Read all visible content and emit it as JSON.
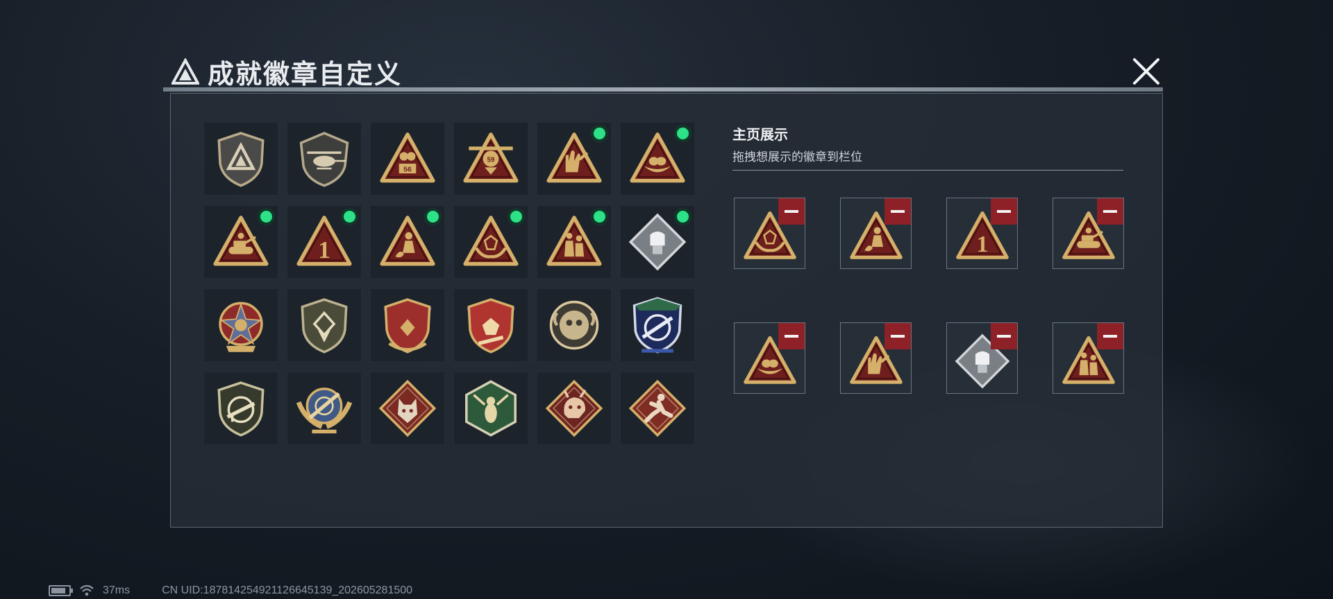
{
  "header": {
    "title": "成就徽章自定义"
  },
  "colors": {
    "accent_green": "#2ee088",
    "remove_red": "#8e2027",
    "panel_bg": "#262d37",
    "gold": "#d4b06a",
    "maroon": "#6e1e1c"
  },
  "badges": [
    {
      "id": "b1",
      "icon": "shield-triangle-logo-badge-icon",
      "unlocked": false
    },
    {
      "id": "b2",
      "icon": "helicopter-shield-badge-icon",
      "unlocked": false
    },
    {
      "id": "b3",
      "icon": "triangle-56-badge-icon",
      "unlocked": false
    },
    {
      "id": "b4",
      "icon": "triangle-plane-badge-icon",
      "unlocked": false
    },
    {
      "id": "b5",
      "icon": "triangle-hand-badge-icon",
      "unlocked": true
    },
    {
      "id": "b6",
      "icon": "triangle-nest-badge-icon",
      "unlocked": true
    },
    {
      "id": "b7",
      "icon": "triangle-tank-badge-icon",
      "unlocked": true
    },
    {
      "id": "b8",
      "icon": "triangle-number-one-badge-icon",
      "unlocked": true
    },
    {
      "id": "b9",
      "icon": "triangle-digger-badge-icon",
      "unlocked": true
    },
    {
      "id": "b10",
      "icon": "triangle-hands-dice-badge-icon",
      "unlocked": true
    },
    {
      "id": "b11",
      "icon": "triangle-soldiers-badge-icon",
      "unlocked": true
    },
    {
      "id": "b12",
      "icon": "diamond-fist-badge-icon",
      "unlocked": true
    },
    {
      "id": "b13",
      "icon": "star-medal-badge-icon",
      "unlocked": false
    },
    {
      "id": "b14",
      "icon": "olive-shield-badge-icon",
      "unlocked": false
    },
    {
      "id": "b15",
      "icon": "stars-shield-badge-icon",
      "unlocked": false
    },
    {
      "id": "b16",
      "icon": "red-stars-shield-badge-icon",
      "unlocked": false
    },
    {
      "id": "b17",
      "icon": "round-skull-badge-icon",
      "unlocked": false
    },
    {
      "id": "b18",
      "icon": "crosshair-rifle-badge-icon",
      "unlocked": false
    },
    {
      "id": "b19",
      "icon": "rifle-shield-badge-icon",
      "unlocked": false
    },
    {
      "id": "b20",
      "icon": "wings-crosshair-badge-icon",
      "unlocked": false
    },
    {
      "id": "b21",
      "icon": "wolf-diamond-badge-icon",
      "unlocked": false
    },
    {
      "id": "b22",
      "icon": "hornet-hexagon-badge-icon",
      "unlocked": false
    },
    {
      "id": "b23",
      "icon": "dragon-diamond-badge-icon",
      "unlocked": false
    },
    {
      "id": "b24",
      "icon": "runner-diamond-badge-icon",
      "unlocked": false
    }
  ],
  "showcase": {
    "title": "主页展示",
    "subtitle": "拖拽想展示的徽章到栏位",
    "slots": [
      {
        "icon": "triangle-hands-dice-badge-icon"
      },
      {
        "icon": "triangle-digger-badge-icon"
      },
      {
        "icon": "triangle-number-one-badge-icon"
      },
      {
        "icon": "triangle-tank-badge-icon"
      },
      {
        "icon": "triangle-nest-badge-icon"
      },
      {
        "icon": "triangle-hand-badge-icon"
      },
      {
        "icon": "diamond-fist-badge-icon"
      },
      {
        "icon": "triangle-soldiers-badge-icon"
      }
    ]
  },
  "status_bar": {
    "ping": "37ms",
    "uid": "CN UID:187814254921126645139_202605281500"
  }
}
